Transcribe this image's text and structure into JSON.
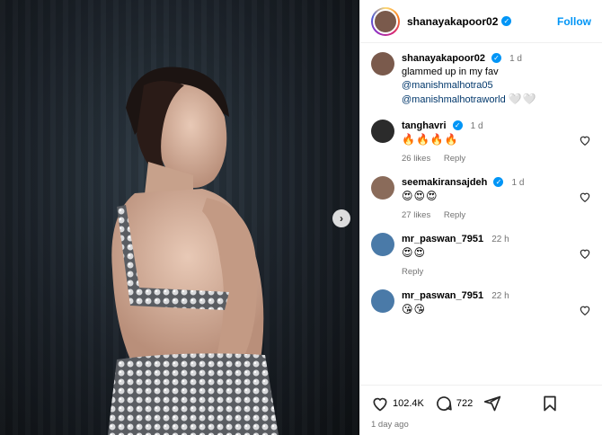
{
  "post": {
    "author": "shanayakapoor02",
    "follow_label": "Follow",
    "caption": {
      "username": "shanayakapoor02",
      "time": "1 d",
      "text": "glammed up in my fav",
      "mention1": "@manishmalhotra05",
      "mention2": "@manishmalhotraworld",
      "trail": "🤍🤍"
    },
    "comments": [
      {
        "username": "tanghavri",
        "verified": true,
        "time": "1 d",
        "text": "🔥🔥🔥🔥",
        "likes": "26 likes",
        "reply": "Reply",
        "avatar_color": "#2b2b2b"
      },
      {
        "username": "seemakiransajdeh",
        "verified": true,
        "time": "1 d",
        "text": "😍😍😍",
        "likes": "27 likes",
        "reply": "Reply",
        "avatar_color": "#8a6b5a"
      },
      {
        "username": "mr_paswan_7951",
        "verified": false,
        "time": "22 h",
        "text": "😍😍",
        "likes": "",
        "reply": "Reply",
        "avatar_color": "#4a7aa8"
      },
      {
        "username": "mr_paswan_7951",
        "verified": false,
        "time": "22 h",
        "text": "😘😘",
        "likes": "",
        "reply": "",
        "avatar_color": "#4a7aa8"
      }
    ],
    "like_count": "102.4K",
    "comment_count": "722",
    "posted": "1 day ago"
  },
  "colors": {
    "accent": "#0095f6",
    "muted": "#737373"
  },
  "icons": [
    "heart-icon",
    "comment-icon",
    "share-icon",
    "bookmark-icon",
    "chevron-right-icon",
    "verified-icon"
  ]
}
